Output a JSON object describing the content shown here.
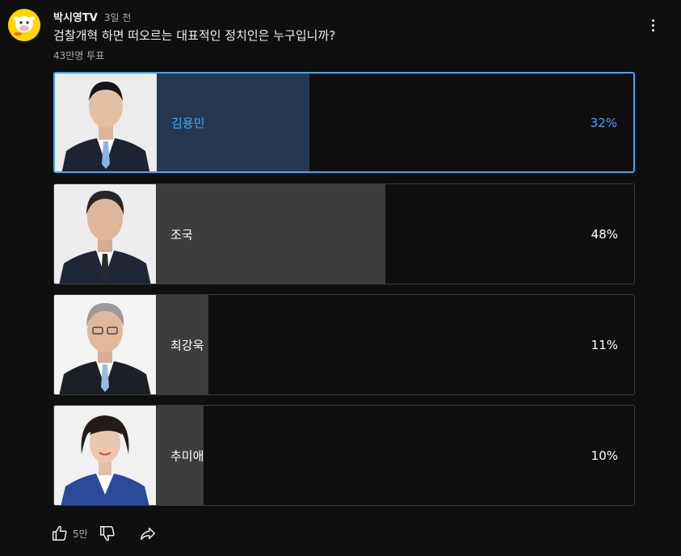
{
  "channel": {
    "name": "박시영TV",
    "time": "3일 전",
    "avatar_color": "#ffd600"
  },
  "poll": {
    "question": "검찰개혁 하면 떠오르는 대표적인 정치인은 누구입니까?",
    "vote_count": "43만명 투표",
    "selected_color": "#3ea6ff",
    "options": [
      {
        "label": "김용민",
        "percent_text": "32%",
        "percent": 32,
        "selected": true
      },
      {
        "label": "조국",
        "percent_text": "48%",
        "percent": 48,
        "selected": false
      },
      {
        "label": "최강욱",
        "percent_text": "11%",
        "percent": 11,
        "selected": false
      },
      {
        "label": "추미애",
        "percent_text": "10%",
        "percent": 10,
        "selected": false
      }
    ]
  },
  "actions": {
    "like_count": "5만",
    "icons": [
      "thumbs-up-icon",
      "thumbs-down-icon",
      "share-icon",
      "more-vert-icon"
    ]
  }
}
